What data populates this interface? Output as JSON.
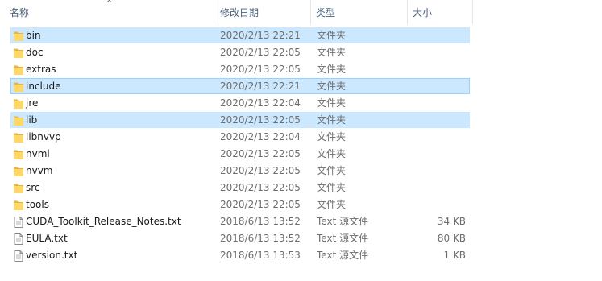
{
  "columns": {
    "name": "名称",
    "date": "修改日期",
    "type": "类型",
    "size": "大小"
  },
  "files": [
    {
      "name": "bin",
      "date": "2020/2/13 22:21",
      "type": "文件夹",
      "size": "",
      "icon": "folder-icon",
      "selected": true,
      "focused": false
    },
    {
      "name": "doc",
      "date": "2020/2/13 22:05",
      "type": "文件夹",
      "size": "",
      "icon": "folder-icon",
      "selected": false,
      "focused": false
    },
    {
      "name": "extras",
      "date": "2020/2/13 22:05",
      "type": "文件夹",
      "size": "",
      "icon": "folder-icon",
      "selected": false,
      "focused": false
    },
    {
      "name": "include",
      "date": "2020/2/13 22:21",
      "type": "文件夹",
      "size": "",
      "icon": "folder-icon",
      "selected": true,
      "focused": true
    },
    {
      "name": "jre",
      "date": "2020/2/13 22:04",
      "type": "文件夹",
      "size": "",
      "icon": "folder-icon",
      "selected": false,
      "focused": false
    },
    {
      "name": "lib",
      "date": "2020/2/13 22:05",
      "type": "文件夹",
      "size": "",
      "icon": "folder-icon",
      "selected": true,
      "focused": false
    },
    {
      "name": "libnvvp",
      "date": "2020/2/13 22:04",
      "type": "文件夹",
      "size": "",
      "icon": "folder-icon",
      "selected": false,
      "focused": false
    },
    {
      "name": "nvml",
      "date": "2020/2/13 22:05",
      "type": "文件夹",
      "size": "",
      "icon": "folder-icon",
      "selected": false,
      "focused": false
    },
    {
      "name": "nvvm",
      "date": "2020/2/13 22:05",
      "type": "文件夹",
      "size": "",
      "icon": "folder-icon",
      "selected": false,
      "focused": false
    },
    {
      "name": "src",
      "date": "2020/2/13 22:05",
      "type": "文件夹",
      "size": "",
      "icon": "folder-icon",
      "selected": false,
      "focused": false
    },
    {
      "name": "tools",
      "date": "2020/2/13 22:05",
      "type": "文件夹",
      "size": "",
      "icon": "folder-icon",
      "selected": false,
      "focused": false
    },
    {
      "name": "CUDA_Toolkit_Release_Notes.txt",
      "date": "2018/6/13 13:52",
      "type": "Text 源文件",
      "size": "34 KB",
      "icon": "text-file-icon",
      "selected": false,
      "focused": false
    },
    {
      "name": "EULA.txt",
      "date": "2018/6/13 13:52",
      "type": "Text 源文件",
      "size": "80 KB",
      "icon": "text-file-icon",
      "selected": false,
      "focused": false
    },
    {
      "name": "version.txt",
      "date": "2018/6/13 13:53",
      "type": "Text 源文件",
      "size": "1 KB",
      "icon": "text-file-icon",
      "selected": false,
      "focused": false
    }
  ],
  "colors": {
    "selection_fill": "#cce8ff",
    "focus_border": "#99d1ff",
    "folder_yellow": "#ffd766",
    "header_text": "#4c607a"
  }
}
